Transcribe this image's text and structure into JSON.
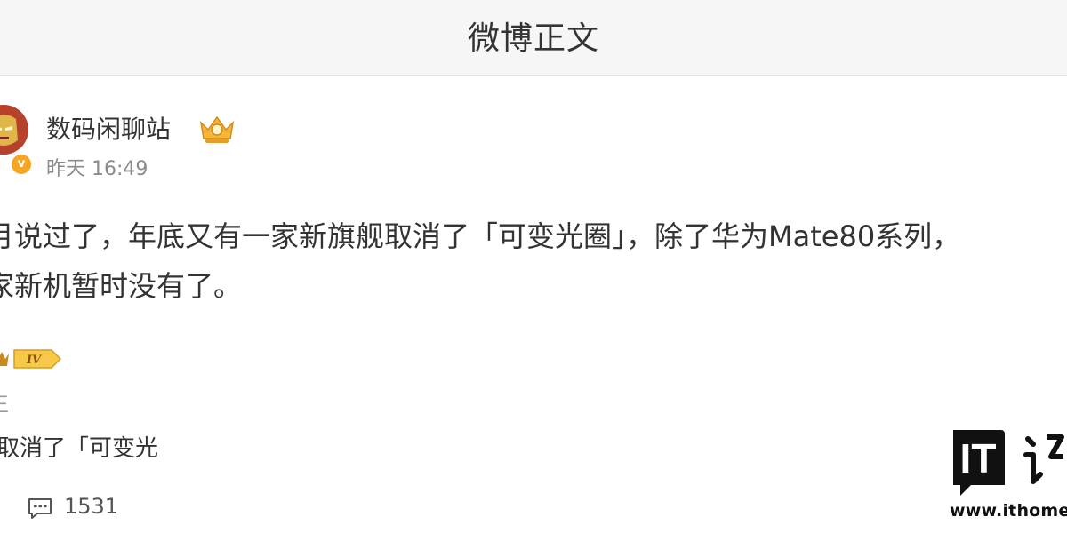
{
  "nav": {
    "title": "微博正文"
  },
  "post": {
    "username": "数码闲聊站",
    "time": "昨天 16:49",
    "line1": "月说过了，年底又有一家新旗舰取消了「可变光圈」，除了华为Mate80系列，",
    "line2": "家新机暂时没有了。",
    "level": "IV"
  },
  "preview": {
    "small_char": "王",
    "text": "取消了「可变光"
  },
  "actions": {
    "comment_count": "1531"
  },
  "watermark": {
    "logo": "IT",
    "site": "www.ithome"
  }
}
